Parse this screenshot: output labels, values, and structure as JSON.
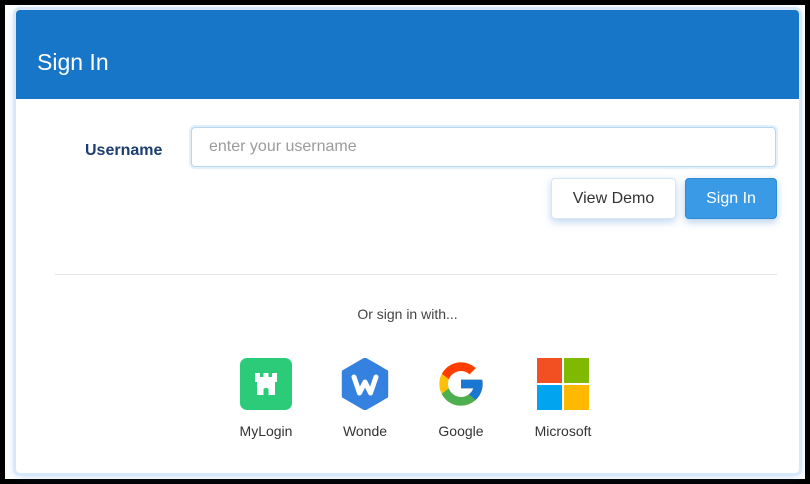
{
  "header": {
    "title": "Sign In"
  },
  "form": {
    "username_label": "Username",
    "username_value": "",
    "username_placeholder": "enter your username",
    "view_demo_label": "View Demo",
    "sign_in_label": "Sign In"
  },
  "alt_signin": {
    "prompt": "Or sign in with...",
    "providers": [
      {
        "label": "MyLogin",
        "icon": "mylogin-icon"
      },
      {
        "label": "Wonde",
        "icon": "wonde-icon"
      },
      {
        "label": "Google",
        "icon": "google-icon"
      },
      {
        "label": "Microsoft",
        "icon": "microsoft-icon"
      }
    ]
  },
  "colors": {
    "header": "#1776c8",
    "primary_button": "#3a9ae6",
    "label": "#1c3d6e",
    "mylogin": "#2bcb7a",
    "wonde": "#3581e0",
    "microsoft_red": "#f25022",
    "microsoft_green": "#7fba00",
    "microsoft_blue": "#00a4ef",
    "microsoft_yellow": "#ffb900"
  }
}
